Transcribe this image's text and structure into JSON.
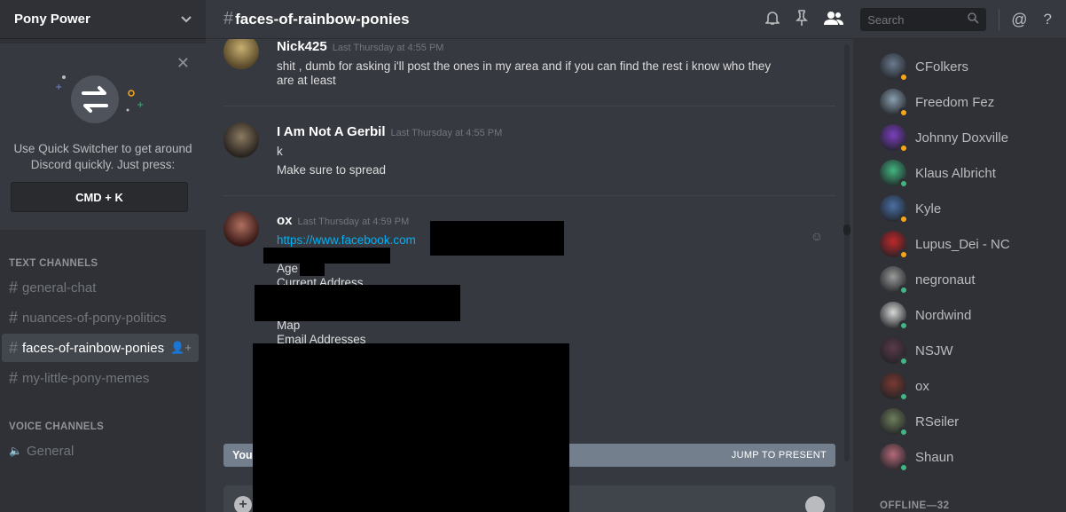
{
  "server": {
    "name": "Pony Power"
  },
  "quick_switcher": {
    "text_line1": "Use Quick Switcher to get around",
    "text_line2": "Discord quickly. Just press:",
    "shortcut": "CMD + K"
  },
  "categories": {
    "text": "TEXT CHANNELS",
    "voice": "VOICE CHANNELS"
  },
  "channels": [
    {
      "name": "general-chat"
    },
    {
      "name": "nuances-of-pony-politics"
    },
    {
      "name": "faces-of-rainbow-ponies",
      "active": true
    },
    {
      "name": "my-little-pony-memes"
    }
  ],
  "voice_channels": [
    {
      "name": "General"
    }
  ],
  "header": {
    "channel": "faces-of-rainbow-ponies",
    "search_placeholder": "Search"
  },
  "messages": [
    {
      "author": "Nick425",
      "timestamp": "Last Thursday at 4:55 PM",
      "lines": [
        "shit , dumb for asking i'll post the ones in my area and if you can find the rest i know who they",
        "are at least"
      ]
    },
    {
      "author": "I Am Not A Gerbil",
      "timestamp": "Last Thursday at 4:55 PM",
      "lines": [
        "k",
        "Make sure to spread"
      ]
    },
    {
      "author": "ox",
      "timestamp": "Last Thursday at 4:59 PM",
      "link": "https://www.facebook.com",
      "lines": [
        "Age",
        "Current Address",
        "Map",
        "Email Addresses"
      ]
    }
  ],
  "jump_bar": {
    "left_text": "You",
    "button": "JUMP TO PRESENT"
  },
  "members": [
    {
      "name": "CFolkers",
      "status": "idle",
      "color": "#6b7a8f"
    },
    {
      "name": "Freedom Fez",
      "status": "idle",
      "color": "#8a9fb0"
    },
    {
      "name": "Johnny Doxville",
      "status": "idle",
      "color": "#7b3fbf"
    },
    {
      "name": "Klaus Albricht",
      "status": "online",
      "color": "#43b581"
    },
    {
      "name": "Kyle",
      "status": "idle",
      "color": "#4a6fa5"
    },
    {
      "name": "Lupus_Dei - NC",
      "status": "idle",
      "color": "#c0282b"
    },
    {
      "name": "negronaut",
      "status": "online",
      "color": "#9a9a9a"
    },
    {
      "name": "Nordwind",
      "status": "online",
      "color": "#d8d8d8"
    },
    {
      "name": "NSJW",
      "status": "online",
      "color": "#5a3a4a"
    },
    {
      "name": "ox",
      "status": "online",
      "color": "#7a3a32"
    },
    {
      "name": "RSeiler",
      "status": "online",
      "color": "#6e7d5a"
    },
    {
      "name": "Shaun",
      "status": "online",
      "color": "#b46a7a"
    }
  ],
  "offline_label": "OFFLINE—32"
}
